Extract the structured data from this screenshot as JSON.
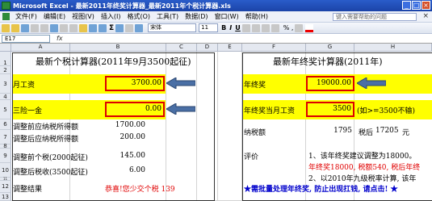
{
  "window": {
    "title": "Microsoft Excel - 最新2011年终奖计算器_最新2011年个税计算器.xls"
  },
  "menu": {
    "items": [
      "文件(F)",
      "编辑(E)",
      "视图(V)",
      "插入(I)",
      "格式(O)",
      "工具(T)",
      "数据(D)",
      "窗口(W)",
      "帮助(H)"
    ],
    "help_placeholder": "键入需要帮助的问题"
  },
  "toolbar": {
    "font": "宋体",
    "size": "11",
    "bold": "B",
    "italic": "I",
    "underline": "U",
    "percent": "% ,"
  },
  "formula_bar": {
    "cell_ref": "E17",
    "fx": "fx",
    "content": ""
  },
  "columns": {
    "left": [
      "A",
      "B",
      "C",
      "D"
    ],
    "right": [
      "E",
      "F",
      "G",
      "H"
    ]
  },
  "rows": [
    "1",
    "2",
    "3",
    "4",
    "5",
    "6",
    "7",
    "8",
    "9",
    "10",
    "11",
    "12",
    "13"
  ],
  "left_panel": {
    "title": "最新个税计算器(2011年9月3500起征)",
    "monthly_salary_label": "月工资",
    "monthly_salary_value": "3700.00",
    "insurance_label": "三险一金",
    "insurance_value": "0.00",
    "pre_taxable_label": "调整前应纳税所得额",
    "pre_taxable_value": "1700.00",
    "post_taxable_label": "调整后应纳税所得额",
    "post_taxable_value": "200.00",
    "pre_tax_label": "调整前个税(2000起征)",
    "pre_tax_value": "145.00",
    "post_tax_label": "调整后税收(3500起征)",
    "post_tax_value": "6.00",
    "result_label": "调整结果",
    "result_value": "恭喜!您少交个税  139"
  },
  "right_panel": {
    "title": "最新年终奖计算器(2011年)",
    "bonus_label": "年终奖",
    "bonus_value": "19000.00",
    "bonus_month_salary_label": "年终奖当月工资",
    "bonus_month_salary_value": "3500",
    "bonus_month_note": "(如>=3500不输)",
    "tax_label": "纳税额",
    "tax_value": "1795",
    "after_tax_label": "税后",
    "after_tax_value": "17205",
    "after_tax_unit": "元",
    "eval_label": "评价",
    "eval_line1": "1、该年终奖建议调整为18000。",
    "eval_line2": "年终奖18000, 税额540, 税后年终",
    "eval_line3": "2、以2010年九级税率计算, 该年",
    "link_text": "★需批量处理年终奖, 防止出现扛钱, 请点击! ★"
  },
  "colors": {
    "highlight": "#ffff00",
    "red": "#e00000",
    "arrow_blue": "#4a6fa5",
    "link_blue": "#0000cc"
  }
}
